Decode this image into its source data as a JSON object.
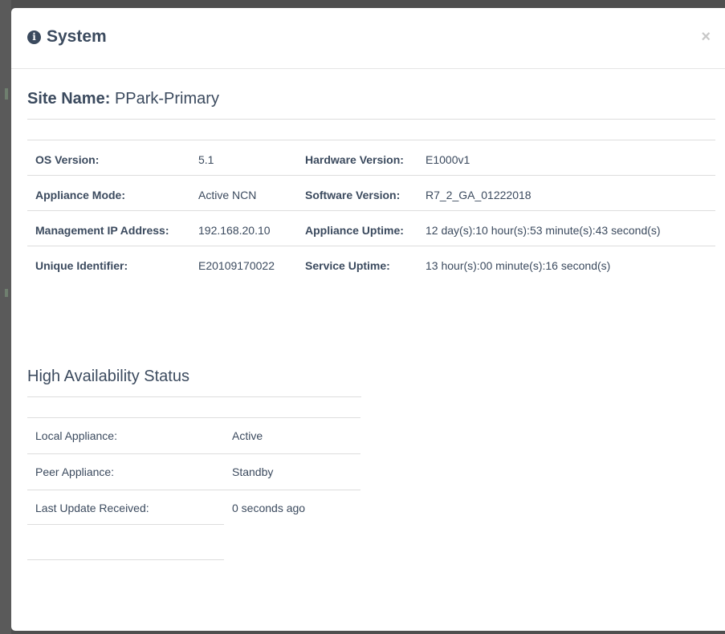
{
  "modal": {
    "title": "System",
    "title_icon": "info-circle-icon",
    "close_label": "×"
  },
  "site": {
    "label": "Site Name:",
    "value": "PPark-Primary"
  },
  "system_info": [
    {
      "left_label": "OS Version:",
      "left_value": "5.1",
      "right_label": "Hardware Version:",
      "right_value": "E1000v1"
    },
    {
      "left_label": "Appliance Mode:",
      "left_value": "Active NCN",
      "right_label": "Software Version:",
      "right_value": "R7_2_GA_01222018"
    },
    {
      "left_label": "Management IP Address:",
      "left_value": "192.168.20.10",
      "right_label": "Appliance Uptime:",
      "right_value": "12 day(s):10 hour(s):53 minute(s):43 second(s)"
    },
    {
      "left_label": "Unique Identifier:",
      "left_value": "E20109170022",
      "right_label": "Service Uptime:",
      "right_value": "13 hour(s):00 minute(s):16 second(s)"
    }
  ],
  "high_availability": {
    "title": "High Availability Status",
    "rows": [
      {
        "label": "Local Appliance:",
        "value": "Active"
      },
      {
        "label": "Peer Appliance:",
        "value": "Standby"
      },
      {
        "label": "Last Update Received:",
        "value": "0 seconds ago"
      }
    ]
  }
}
